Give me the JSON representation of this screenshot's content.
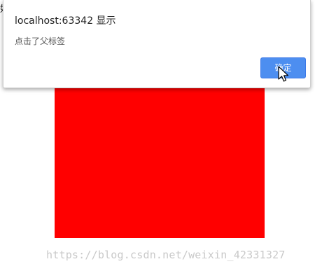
{
  "background_page": {
    "corner_glyph": "好",
    "red_box_color": "#ff0000"
  },
  "dialog": {
    "title": "localhost:63342 显示",
    "message": "点击了父标签",
    "ok_label": "确定",
    "ok_color": "#4d8ef0"
  },
  "cursor_icon": "mouse-pointer-icon",
  "watermark": "https://blog.csdn.net/weixin_42331327"
}
